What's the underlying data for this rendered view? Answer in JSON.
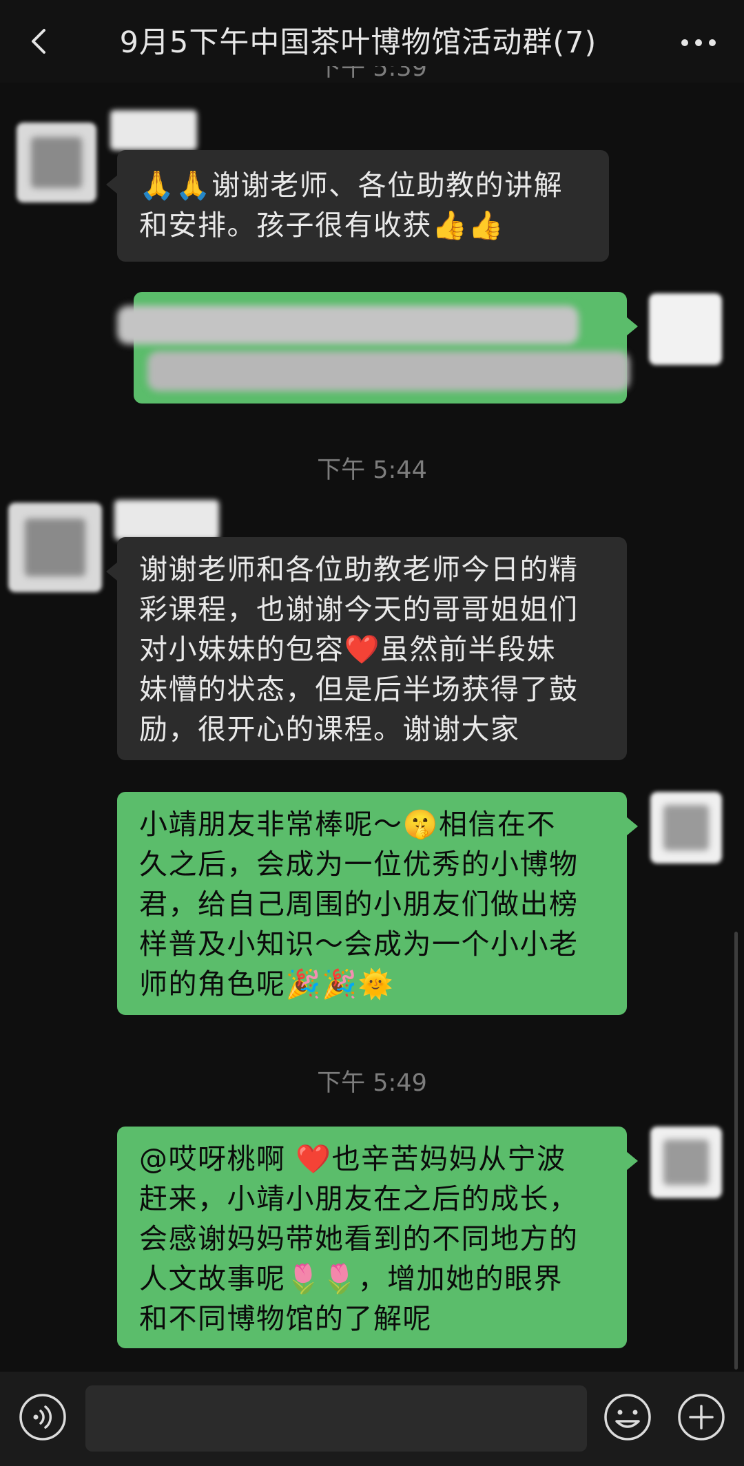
{
  "header": {
    "title": "9月5下午中国茶叶博物馆活动群(7)"
  },
  "timestamps": {
    "top_cut": "下午 5:39",
    "t1": "下午 5:44",
    "t2": "下午 5:49"
  },
  "messages": {
    "m1": {
      "lines": [
        "🙏🙏谢谢老师、各位助教的讲解",
        "和安排。孩子很有收获👍👍"
      ]
    },
    "m3": {
      "lines": [
        "谢谢老师和各位助教老师今日的精",
        "彩课程，也谢谢今天的哥哥姐姐们",
        "对小妹妹的包容❤️虽然前半段妹",
        "妹懵的状态，但是后半场获得了鼓",
        "励，很开心的课程。谢谢大家"
      ]
    },
    "m4": {
      "lines": [
        "小靖朋友非常棒呢～🤫相信在不",
        "久之后，会成为一位优秀的小博物",
        "君，给自己周围的小朋友们做出榜",
        "样普及小知识～会成为一个小小老",
        "师的角色呢🎉🎉🌞"
      ]
    },
    "m5": {
      "lines": [
        "@哎呀桃啊 ❤️也辛苦妈妈从宁波",
        "赶来，小靖小朋友在之后的成长，",
        "会感谢妈妈带她看到的不同地方的",
        "人文故事呢🌷🌷，增加她的眼界",
        "和不同博物馆的了解呢"
      ]
    }
  },
  "colors": {
    "background": "#0f0f0f",
    "incoming_bubble": "#2c2c2c",
    "outgoing_bubble": "#5bbd6b"
  },
  "icons": {
    "back": "chevron-left-icon",
    "more": "more-dots-icon",
    "voice": "voice-icon",
    "emoji": "smiley-icon",
    "plus": "plus-icon"
  }
}
